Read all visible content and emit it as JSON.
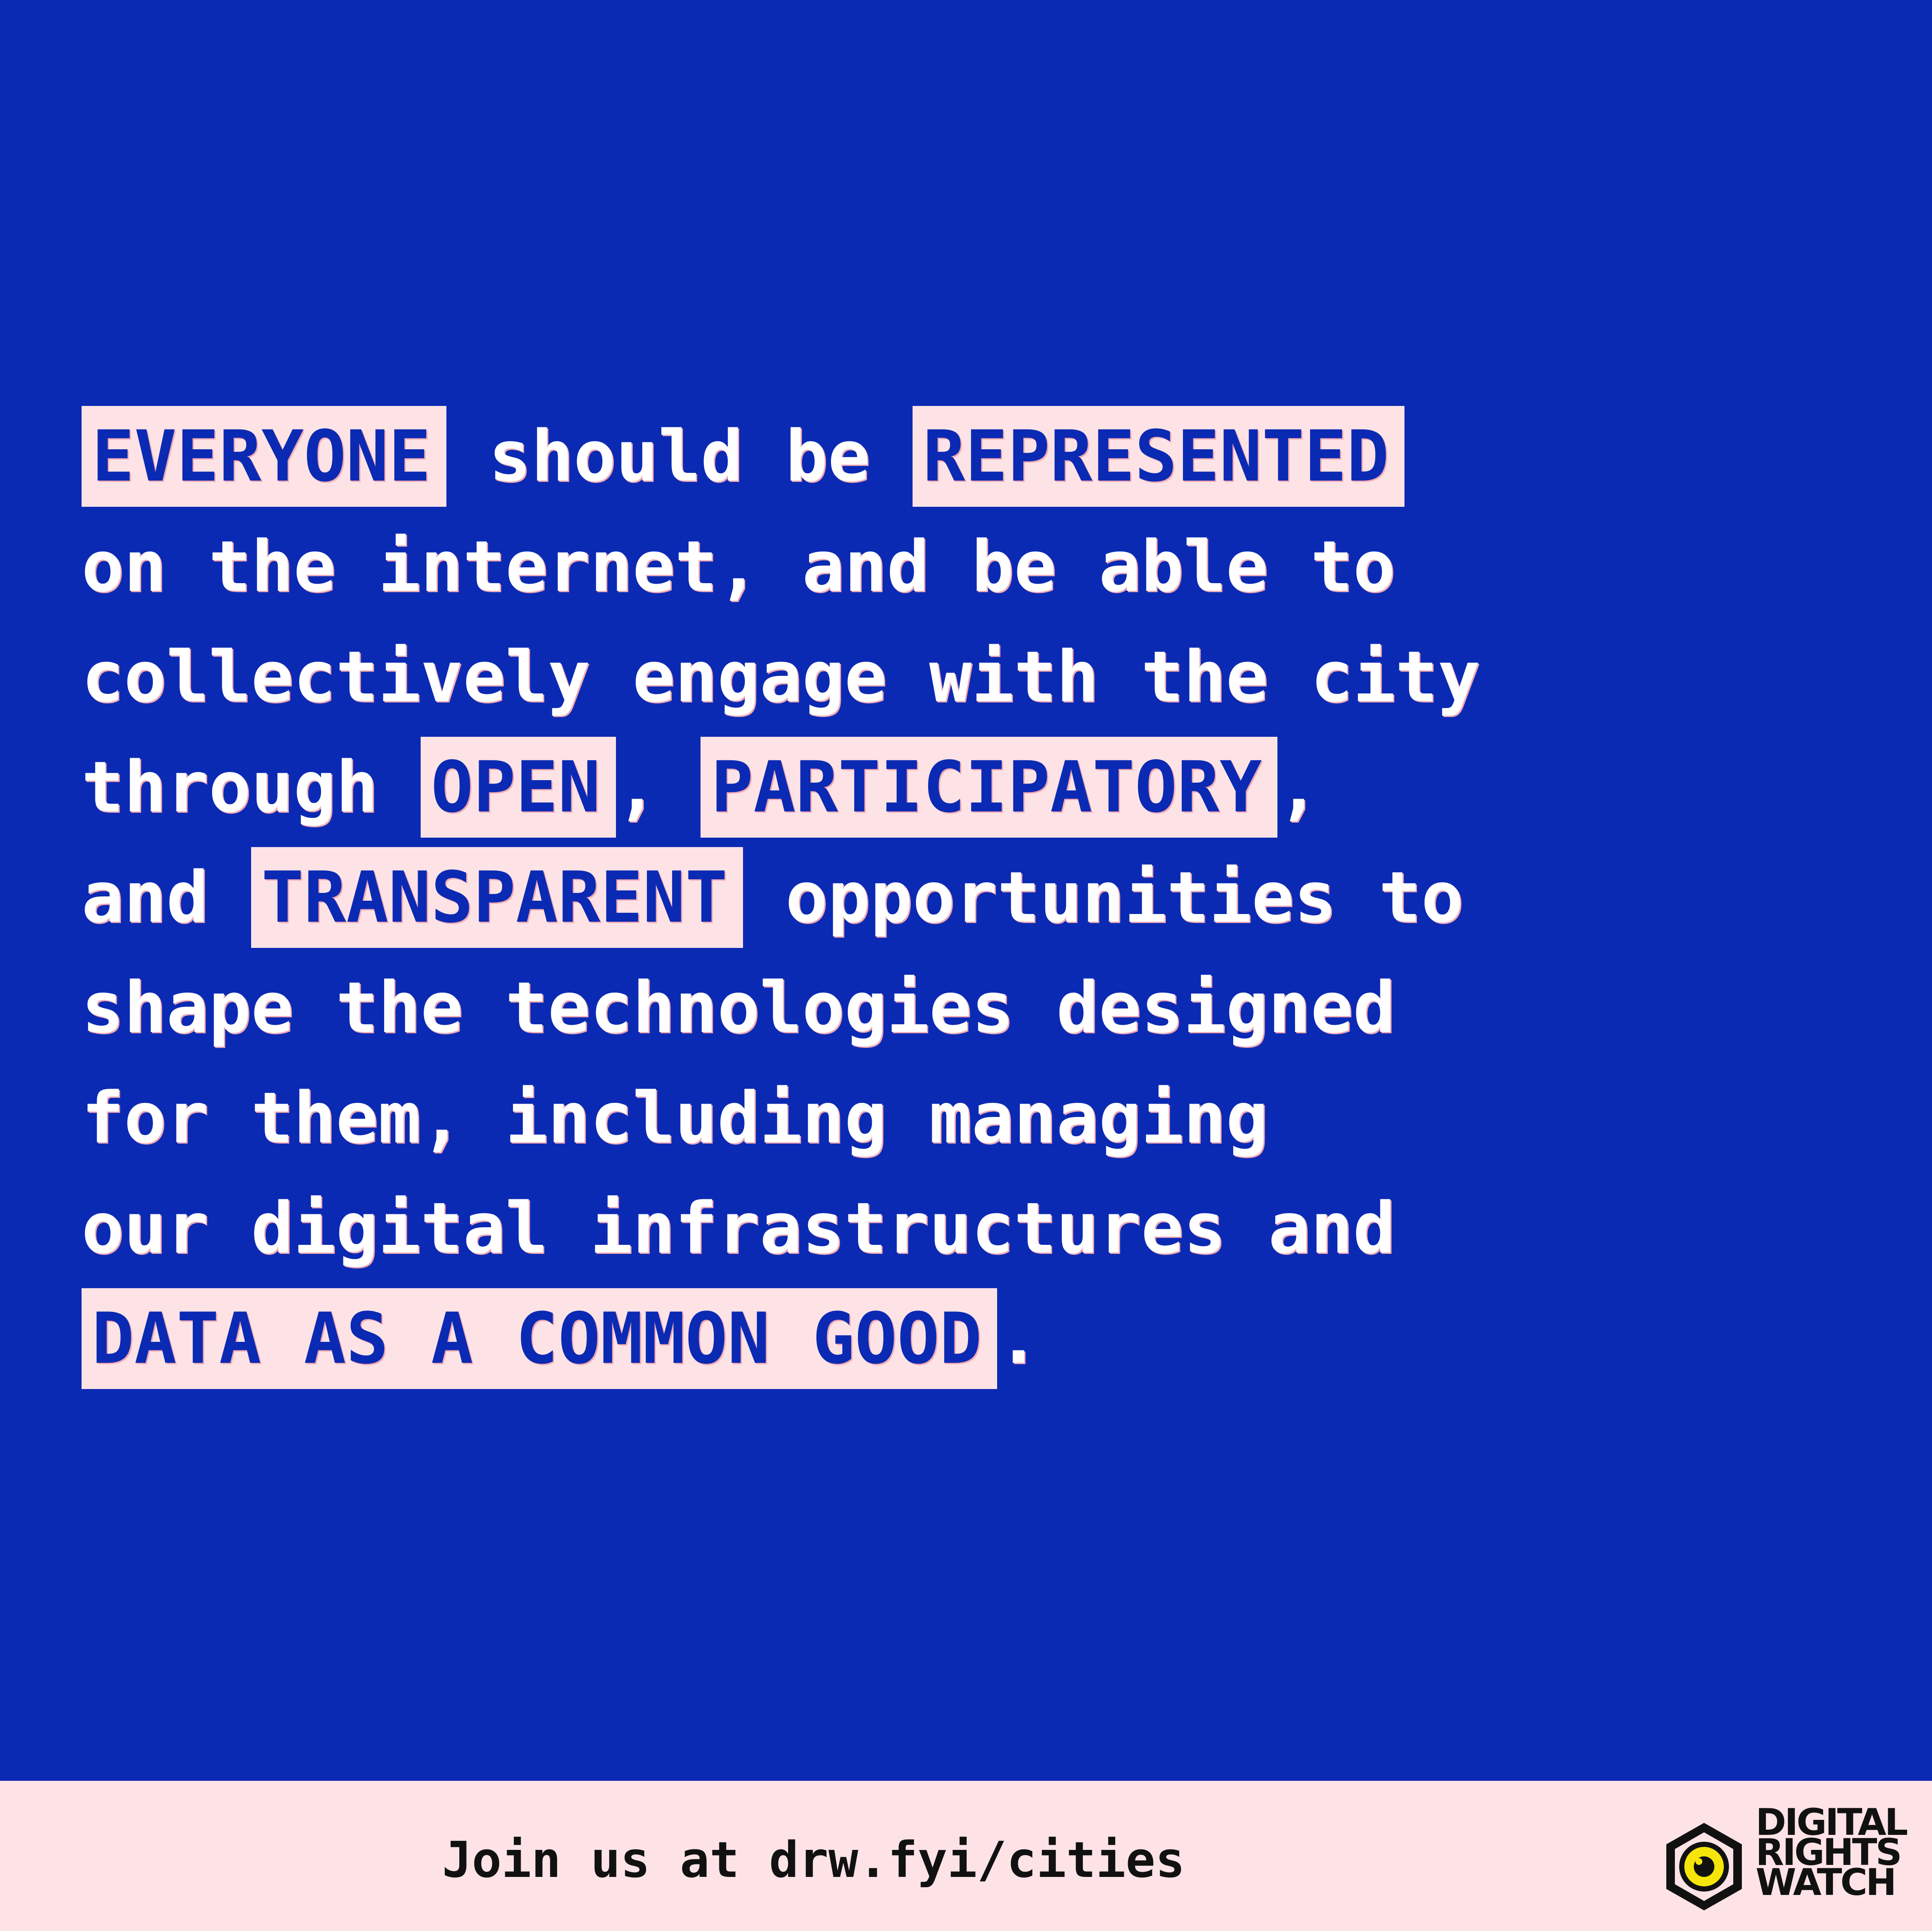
{
  "statement": {
    "line1": {
      "hl1": "EVERYONE",
      "mid": " should be ",
      "hl2": "REPRESENTED"
    },
    "line2": "on the internet, and be able to",
    "line3": "collectively engage with the city",
    "line4": {
      "pre": "through ",
      "hl1": "OPEN",
      "mid": ", ",
      "hl2": "PARTICIPATORY",
      "post": ","
    },
    "line5": {
      "pre": "and ",
      "hl": "TRANSPARENT",
      "post": " opportunities to"
    },
    "line6": "shape the technologies designed",
    "line7": "for them, including managing",
    "line8": "our digital infrastructures and",
    "line9": {
      "hl": "DATA AS A COMMON GOOD",
      "post": "."
    }
  },
  "footer": {
    "cta": "Join us at drw.fyi/cities",
    "logo": {
      "icon": "eye-hexagon-icon",
      "line1": "DIGITAL",
      "line2": "RIGHTS",
      "line3": "WATCH"
    }
  },
  "colors": {
    "background": "#0b2ab3",
    "highlight": "#fde3e6",
    "accent_shadow": "#f2a8b4",
    "logo_yellow": "#f5e50a"
  }
}
